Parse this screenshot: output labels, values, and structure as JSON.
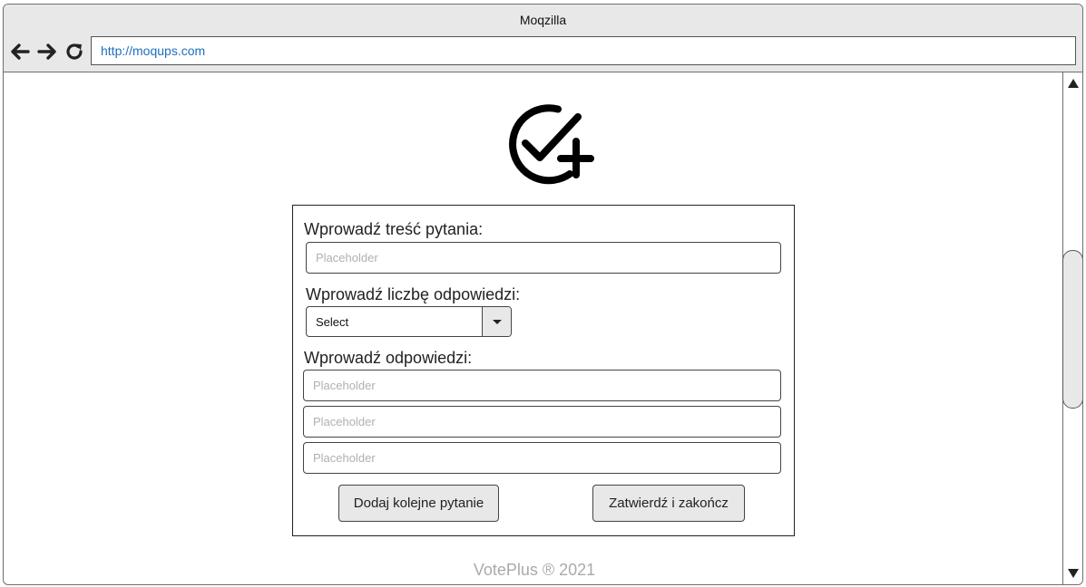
{
  "browser": {
    "title": "Moqzilla",
    "url": "http://moqups.com",
    "icons": {
      "back": "arrow-left-icon",
      "forward": "arrow-right-icon",
      "reload": "reload-icon"
    }
  },
  "logo": {
    "icon": "check-circle-plus-icon"
  },
  "form": {
    "question_label": "Wprowadź treść pytania:",
    "question_placeholder": "Placeholder",
    "count_label": "Wprowadź liczbę odpowiedzi:",
    "count_select": {
      "value": "Select"
    },
    "answers_label": "Wprowadź odpowiedzi:",
    "answers": [
      {
        "placeholder": "Placeholder"
      },
      {
        "placeholder": "Placeholder"
      },
      {
        "placeholder": "Placeholder"
      }
    ],
    "add_button_label": "Dodaj kolejne pytanie",
    "finish_button_label": "Zatwierdź i zakończ"
  },
  "footer": {
    "text": "VotePlus ® 2021"
  }
}
